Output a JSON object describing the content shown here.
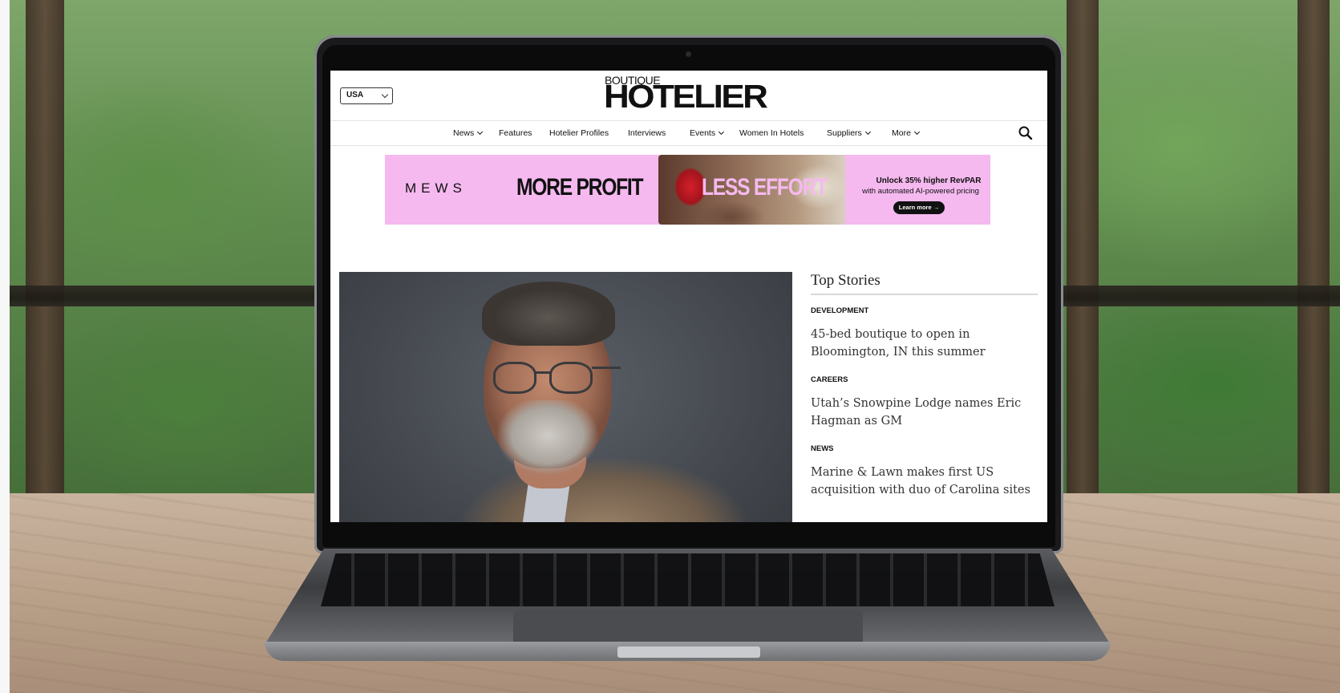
{
  "header": {
    "region_select": "USA",
    "logo_small": "BOUTIQUE",
    "logo_main": "HOTELIER"
  },
  "nav": {
    "items": [
      {
        "label": "News",
        "has_dropdown": true
      },
      {
        "label": "Features",
        "has_dropdown": false
      },
      {
        "label": "Hotelier Profiles",
        "has_dropdown": false
      },
      {
        "label": "Interviews",
        "has_dropdown": false
      },
      {
        "label": "Events",
        "has_dropdown": true
      },
      {
        "label": "Women In Hotels",
        "has_dropdown": false
      },
      {
        "label": "Suppliers",
        "has_dropdown": true
      },
      {
        "label": "More",
        "has_dropdown": true
      }
    ],
    "search_icon": "search-icon"
  },
  "ad": {
    "brand": "MEWS",
    "headline_1": "MORE PROFIT",
    "headline_2": "LESS EFFORT",
    "copy_1": "Unlock 35% higher RevPAR",
    "copy_2": "with automated AI-powered pricing",
    "cta": "Learn more →",
    "background_color": "#f5b9ef"
  },
  "top_stories": {
    "heading": "Top Stories",
    "stories": [
      {
        "category": "DEVELOPMENT",
        "title": "45-bed boutique to open in Bloomington, IN this summer"
      },
      {
        "category": "CAREERS",
        "title": "Utah’s Snowpine Lodge names Eric Hagman as GM"
      },
      {
        "category": "NEWS",
        "title": "Marine & Lawn makes first US acquisition with duo of Carolina sites"
      }
    ]
  }
}
